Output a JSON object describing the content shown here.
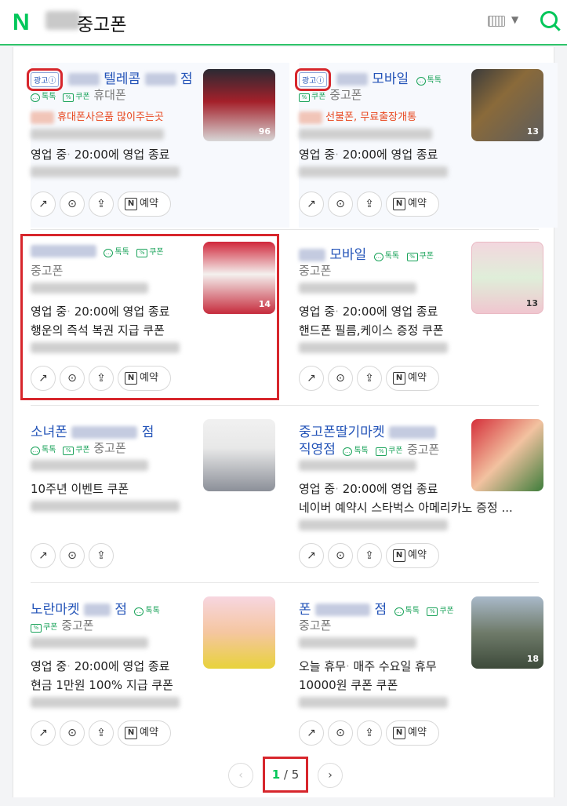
{
  "header": {
    "logo": "N",
    "query": "중고폰"
  },
  "ad_label": "광고ⓘ",
  "chips": {
    "talk": "톡톡",
    "coupon": "쿠폰"
  },
  "actions": {
    "reserve": "예약"
  },
  "cards": [
    {
      "name": "텔레콤",
      "name_tail": "점",
      "category": "휴대폰",
      "promo": "휴대폰사은품 많이주는곳",
      "status": "영업 중",
      "time": "20:00에 영업 종료",
      "count": "96",
      "extra": ""
    },
    {
      "name": "모바일",
      "category": "중고폰",
      "promo": "선불폰, 무료출장개통",
      "status": "영업 중",
      "time": "20:00에 영업 종료",
      "count": "13",
      "extra": ""
    },
    {
      "name": "",
      "category": "중고폰",
      "status": "영업 중",
      "time": "20:00에 영업 종료",
      "extra": "행운의 즉석 복권 지급 쿠폰",
      "count": "14"
    },
    {
      "name": "모바일",
      "category": "중고폰",
      "status": "영업 중",
      "time": "20:00에 영업 종료",
      "extra": "핸드폰 필름,케이스 증정 쿠폰",
      "count": "13"
    },
    {
      "name": "소녀폰",
      "name_tail": "점",
      "category": "중고폰",
      "extra": "10주년 이벤트 쿠폰"
    },
    {
      "name": "중고폰딸기마켓",
      "name2": "직영점",
      "category": "중고폰",
      "status": "영업 중",
      "time": "20:00에 영업 종료",
      "extra": "네이버 예약시 스타벅스 아메리카노 증정 ..."
    },
    {
      "name": "노란마켓",
      "name_tail": "점",
      "category": "중고폰",
      "status": "영업 중",
      "time": "20:00에 영업 종료",
      "extra": "현금 1만원 100% 지급 쿠폰"
    },
    {
      "name": "폰",
      "name_tail": "점",
      "category": "중고폰",
      "status": "오늘 휴무",
      "time": "매주 수요일 휴무",
      "extra": "10000원 쿠폰 쿠폰",
      "count": "18"
    }
  ],
  "pagination": {
    "current": "1",
    "separator": "/",
    "total": "5"
  },
  "colors": {
    "accent": "#03c75a",
    "link": "#2454b8",
    "highlight": "#d7262c",
    "promo": "#e8461d"
  }
}
